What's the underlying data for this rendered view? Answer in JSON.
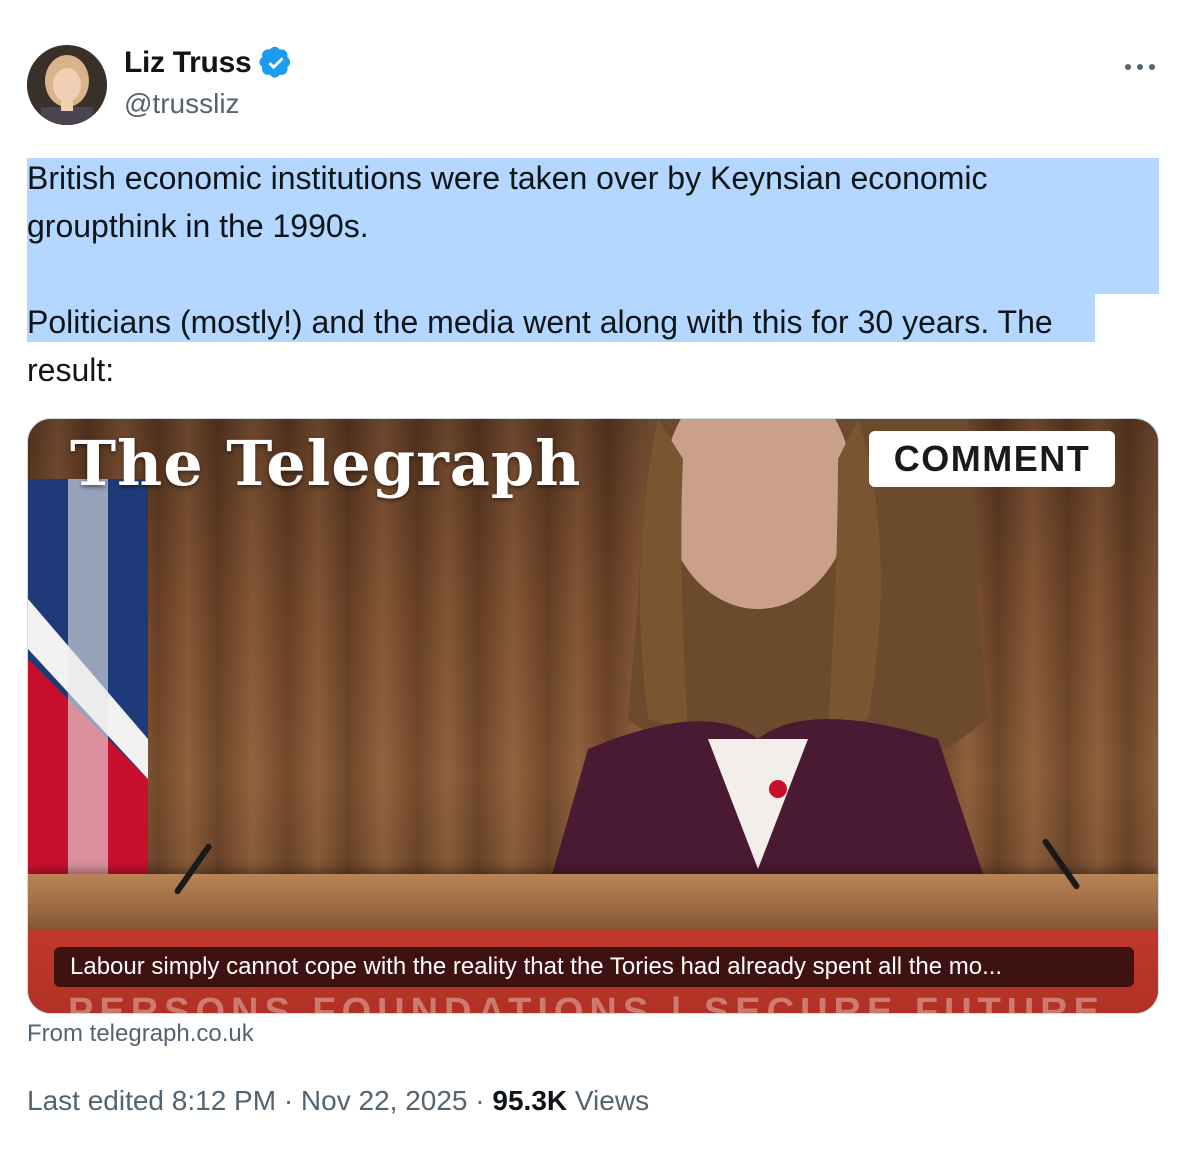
{
  "author": {
    "name": "Liz Truss",
    "handle": "@trussliz",
    "verified": true
  },
  "tweet": {
    "lines": [
      "British economic institutions were taken over by Keynsian economic",
      "groupthink in the 1990s.",
      "Politicians (mostly!) and the media went along with this for 30 years. The",
      "result:"
    ]
  },
  "card": {
    "logo": "The Telegraph",
    "badge": "COMMENT",
    "caption": "Labour simply cannot cope with the reality that the Tories had already spent all the mo...",
    "source": "From telegraph.co.uk"
  },
  "meta": {
    "edited": "Last edited 8:12 PM · Nov 22, 2025 · ",
    "views_count": "95.3K",
    "views_label": " Views"
  },
  "colors": {
    "accent_verified": "#1d9bf0",
    "selection": "#b3d7ff",
    "secondary_text": "#536471"
  }
}
